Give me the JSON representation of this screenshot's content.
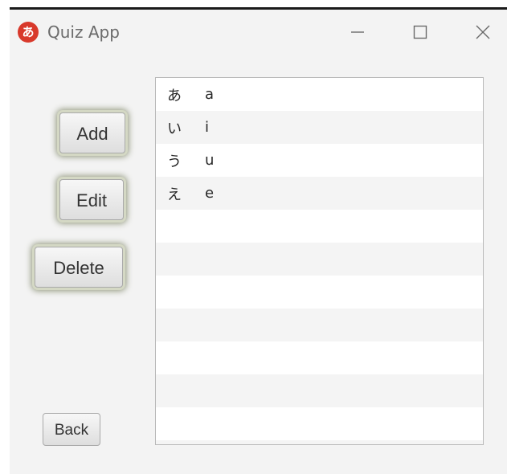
{
  "window": {
    "title": "Quiz App",
    "icon_glyph": "あ",
    "icon_color": "#d8392b"
  },
  "controls": {
    "minimize_icon": "minimize-icon",
    "maximize_icon": "maximize-icon",
    "close_icon": "close-icon"
  },
  "buttons": {
    "add_label": "Add",
    "edit_label": "Edit",
    "delete_label": "Delete",
    "back_label": "Back"
  },
  "list": {
    "items": [
      {
        "kana": "あ",
        "romaji": "a"
      },
      {
        "kana": "い",
        "romaji": "i"
      },
      {
        "kana": "う",
        "romaji": "u"
      },
      {
        "kana": "え",
        "romaji": "e"
      }
    ]
  },
  "colors": {
    "focus_glow": "#8f957a",
    "window_bg": "#f3f3f3"
  }
}
